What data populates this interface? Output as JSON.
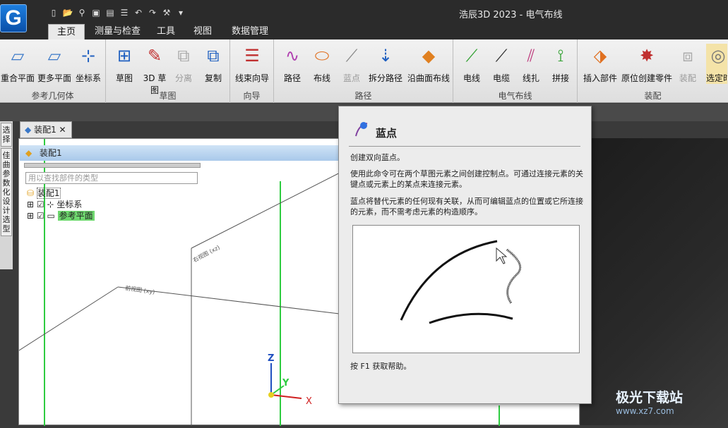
{
  "window": {
    "title": "浩辰3D 2023 - 电气布线"
  },
  "menu_tabs": [
    "主页",
    "测量与检查",
    "工具",
    "视图",
    "数据管理"
  ],
  "ribbon": {
    "ref_geometry": {
      "label": "参考几何体",
      "buttons": [
        "重合平面",
        "更多平面",
        "坐标系"
      ]
    },
    "sketch": {
      "label": "草图",
      "buttons": [
        "草图",
        "3D 草图",
        "分离",
        "复制"
      ]
    },
    "wizard": {
      "label": "向导",
      "buttons": [
        "线束向导"
      ]
    },
    "path": {
      "label": "路径",
      "buttons": [
        "路径",
        "布线",
        "蓝点",
        "拆分路径",
        "沿曲面布线"
      ]
    },
    "electrical": {
      "label": "电气布线",
      "buttons": [
        "电线",
        "电缆",
        "线扎",
        "拼接"
      ]
    },
    "assembly": {
      "label": "装配",
      "buttons": [
        "插入部件",
        "原位创建零件",
        "装配",
        "选定时"
      ]
    }
  },
  "left_tabs": [
    "选择",
    "佳曲参数化设计选型"
  ],
  "document_tab": "装配1",
  "panel": {
    "title": "装配1",
    "search_placeholder": "用以查找部件的类型",
    "tree": {
      "root": "装配1",
      "items": [
        "坐标系",
        "参考平面"
      ]
    }
  },
  "tooltip": {
    "title": "蓝点",
    "p1": "创建双向蓝点。",
    "p2": "使用此命令可在两个草图元素之间创建控制点。可通过连接元素的关键点或元素上的某点来连接元素。",
    "p3": "蓝点将替代元素的任何现有关联，从而可编辑蓝点的位置或它所连接的元素，而不需考虑元素的构造顺序。",
    "help": "按 F1 获取帮助。"
  },
  "viewport": {
    "plane_label_1": "右视图 (xz)",
    "plane_label_2": "前视图 (xy)",
    "axes": {
      "z": "Z",
      "y": "Y",
      "x": "X"
    }
  },
  "watermark": {
    "name": "极光下载站",
    "url": "www.xz7.com"
  }
}
